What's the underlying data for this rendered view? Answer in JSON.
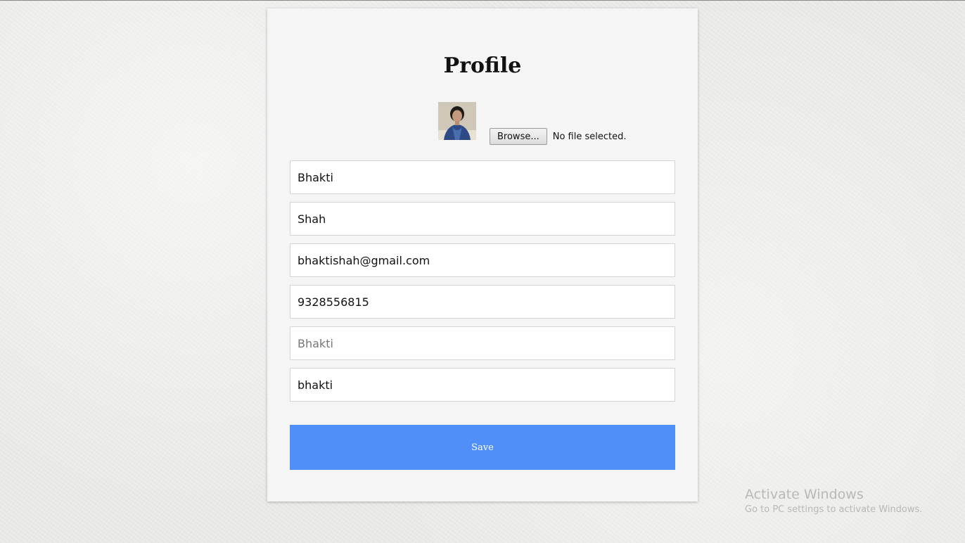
{
  "page": {
    "title": "Profile"
  },
  "photo": {
    "browse_label": "Browse...",
    "file_status": "No file selected."
  },
  "fields": {
    "first_name": {
      "value": "Bhakti"
    },
    "last_name": {
      "value": "Shah"
    },
    "email": {
      "value": "bhaktishah@gmail.com"
    },
    "phone": {
      "value": "9328556815"
    },
    "username": {
      "placeholder": "Bhakti"
    },
    "password": {
      "value": "bhakti"
    }
  },
  "actions": {
    "save_label": "Save"
  },
  "watermark": {
    "title": "Activate Windows",
    "subtitle": "Go to PC settings to activate Windows."
  },
  "colors": {
    "accent": "#4f8ff7",
    "card_background": "#f5f5f5",
    "page_background": "#ececea"
  }
}
